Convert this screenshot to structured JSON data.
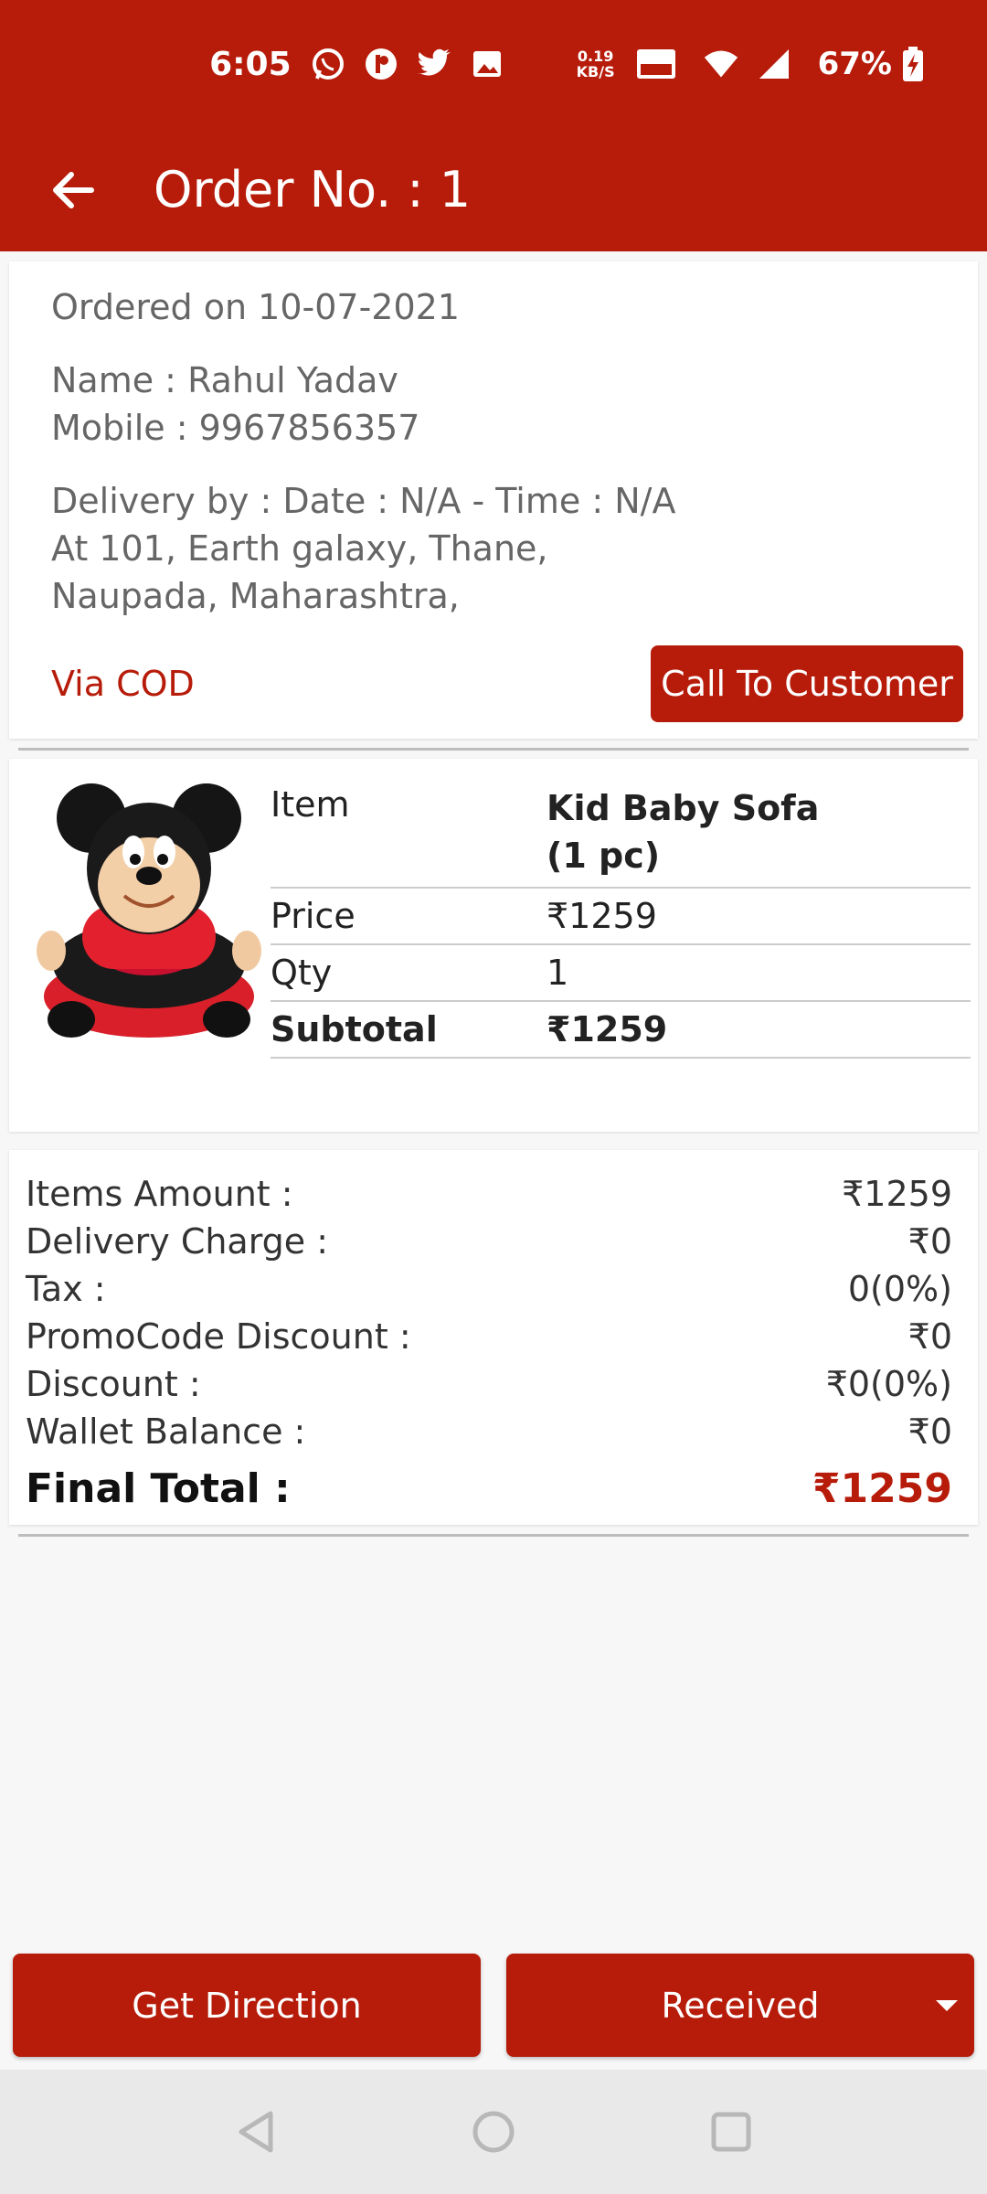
{
  "colors": {
    "primary": "#b71c0b",
    "background": "#f7f7f7",
    "text_muted": "#666666"
  },
  "status_bar": {
    "time": "6:05",
    "icons": [
      "whatsapp-icon",
      "app-icon",
      "twitter-icon",
      "gallery-icon"
    ],
    "net_speed_value": "0.19",
    "net_speed_unit": "KB/S",
    "volte": "Vo¹\nWiFi",
    "battery": "67%"
  },
  "toolbar": {
    "title": "Order No. : 1"
  },
  "order": {
    "ordered_on": "Ordered on 10-07-2021",
    "name": "Name : Rahul Yadav",
    "mobile": "Mobile : 9967856357",
    "delivery_by": "Delivery by : Date : N/A - Time : N/A",
    "address_line1": "At 101, Earth galaxy, Thane,",
    "address_line2": "Naupada, Maharashtra,",
    "payment_method": "Via COD",
    "call_button": "Call To Customer"
  },
  "item": {
    "image_name": "kid-baby-sofa-image",
    "rows": [
      {
        "label": "Item",
        "value": "Kid Baby Sofa",
        "value2": "(1 pc)"
      },
      {
        "label": "Price",
        "value": "₹1259"
      },
      {
        "label": "Qty",
        "value": "1"
      },
      {
        "label": "Subtotal",
        "value": "₹1259"
      }
    ]
  },
  "totals": {
    "rows": [
      {
        "label": "Items Amount :",
        "value": "₹1259"
      },
      {
        "label": "Delivery Charge :",
        "value": "₹0"
      },
      {
        "label": "Tax :",
        "value": "0(0%)"
      },
      {
        "label": "PromoCode Discount :",
        "value": "₹0"
      },
      {
        "label": "Discount :",
        "value": "₹0(0%)"
      },
      {
        "label": "Wallet Balance :",
        "value": "₹0"
      }
    ],
    "final_label": "Final Total :",
    "final_value": "₹1259"
  },
  "actions": {
    "direction": "Get Direction",
    "status": "Received"
  },
  "nav": [
    "back-nav-icon",
    "home-nav-icon",
    "recents-nav-icon"
  ]
}
